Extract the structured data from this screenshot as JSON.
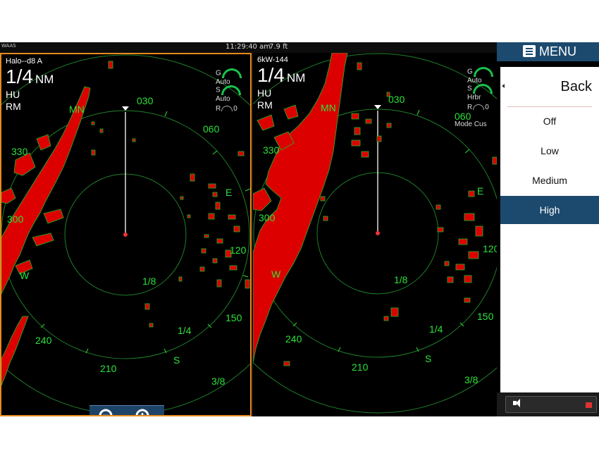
{
  "status": {
    "gps_label": "WAAS",
    "time": "11:29:40 am",
    "depth": "7.9 ft"
  },
  "left_pane": {
    "source": "Halo--d8 A",
    "range_value": "1/4",
    "range_unit": "NM",
    "orientation": "HU",
    "motion": "RM",
    "gain_label": "G",
    "gain_value": "Auto",
    "sea_label": "S",
    "sea_value": "Auto",
    "rain_label": "R",
    "rain_value": "0",
    "bearing_labels": [
      "030",
      "060",
      "E",
      "120",
      "150",
      "S",
      "210",
      "240",
      "W",
      "300",
      "330",
      "MN"
    ],
    "ring_labels": [
      "1/8",
      "1/4",
      "3/8"
    ]
  },
  "right_pane": {
    "source": "6kW-144",
    "range_value": "1/4",
    "range_unit": "NM",
    "orientation": "HU",
    "motion": "RM",
    "gain_label": "G",
    "gain_value": "Auto",
    "sea_label": "S",
    "sea_value": "Hrbr",
    "rain_label": "R",
    "rain_value": "0",
    "mode_label": "Mode",
    "mode_value": "Cus",
    "bearing_labels": [
      "030",
      "060",
      "E",
      "120",
      "150",
      "S",
      "210",
      "240",
      "W",
      "300",
      "330",
      "MN"
    ],
    "ring_labels": [
      "1/8",
      "1/4",
      "3/8"
    ]
  },
  "zoom": {
    "out_icon": "zoom-out-icon",
    "in_icon": "zoom-in-icon"
  },
  "menu": {
    "title": "MENU",
    "back": "Back",
    "options": [
      "Off",
      "Low",
      "Medium",
      "High"
    ],
    "selected": "High"
  },
  "colors": {
    "echo": "#dd0000",
    "rings": "#1f7f2a",
    "labels": "#2de03a",
    "accent": "#1c4a6e",
    "active_border": "#e88a1e"
  }
}
